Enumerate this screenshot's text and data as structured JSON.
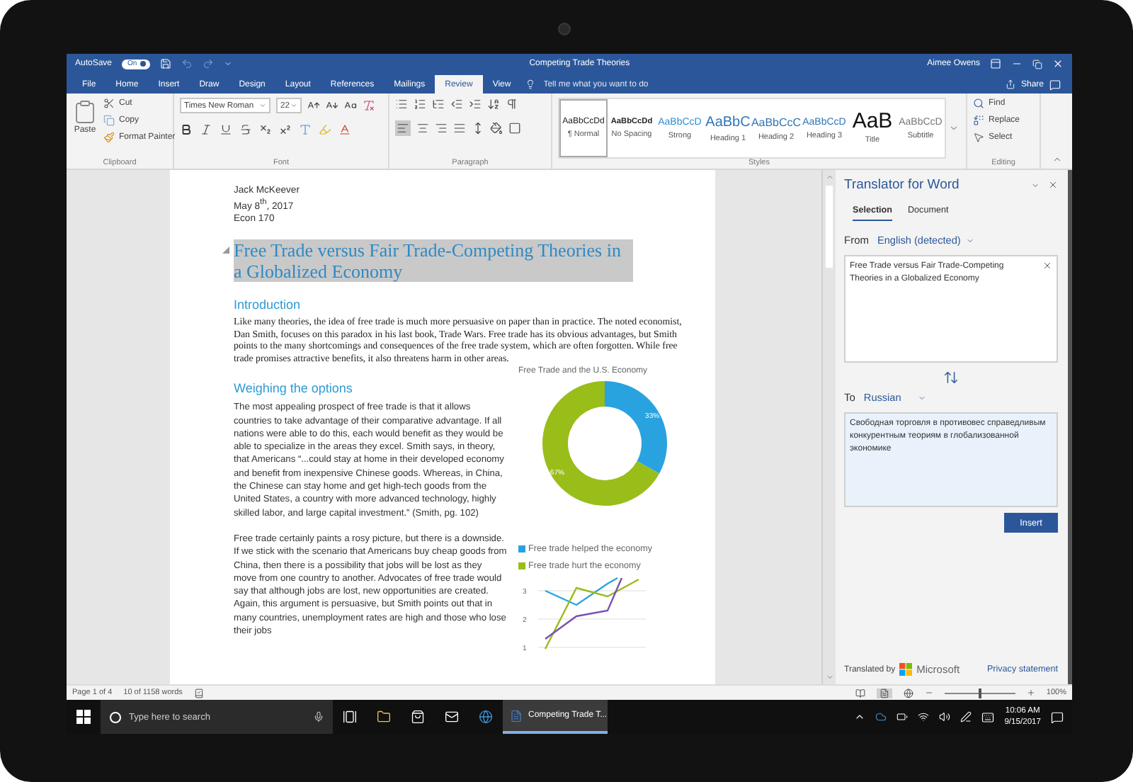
{
  "title_bar": {
    "autosave": {
      "label": "AutoSave",
      "state": "On",
      "on": true
    },
    "document_title": "Competing Trade Theories",
    "user": "Aimee Owens"
  },
  "ribbon_tabs": [
    {
      "label": "File",
      "selected": false
    },
    {
      "label": "Home",
      "selected": false
    },
    {
      "label": "Insert",
      "selected": false
    },
    {
      "label": "Draw",
      "selected": false
    },
    {
      "label": "Design",
      "selected": false
    },
    {
      "label": "Layout",
      "selected": false
    },
    {
      "label": "References",
      "selected": false
    },
    {
      "label": "Mailings",
      "selected": false
    },
    {
      "label": "Review",
      "selected": true
    },
    {
      "label": "View",
      "selected": false
    }
  ],
  "tell_me": {
    "placeholder": "Tell me what you want to do"
  },
  "share": "Share",
  "clipboard": {
    "paste": "Paste",
    "commands": [
      "Cut",
      "Copy",
      "Format Painter"
    ],
    "label": "Clipboard"
  },
  "font": {
    "name": "Times New Roman",
    "size": "22",
    "label": "Font"
  },
  "paragraph": {
    "label": "Paragraph"
  },
  "styles": {
    "items": [
      {
        "kind": "normal",
        "preview": "AaBbCcDd",
        "name": "¶ Normal",
        "selected": true
      },
      {
        "kind": "nospacing",
        "preview": "AaBbCcDd",
        "name": "No Spacing",
        "selected": false
      },
      {
        "kind": "strong",
        "preview": "AaBbCcD",
        "name": "Strong",
        "selected": false
      },
      {
        "kind": "heading1",
        "preview": "AaBbC",
        "name": "Heading 1",
        "selected": false
      },
      {
        "kind": "heading2",
        "preview": "AaBbCcC",
        "name": "Heading 2",
        "selected": false
      },
      {
        "kind": "heading3",
        "preview": "AaBbCcD",
        "name": "Heading 3",
        "selected": false
      },
      {
        "kind": "title",
        "preview": "AaB",
        "name": "Title",
        "selected": false
      },
      {
        "kind": "subtitle",
        "preview": "AaBbCcD",
        "name": "Subtitle",
        "selected": false
      }
    ],
    "label": "Styles"
  },
  "editing": {
    "commands": [
      "Find",
      "Replace",
      "Select"
    ],
    "label": "Editing"
  },
  "document": {
    "author_lines": [
      "Jack McKeever",
      "May 8$^{th}$, 2017",
      "Econ 170"
    ],
    "title": {
      "text": "Free Trade versus Fair Trade-Competing Theories in a Globalized Economy",
      "selected": true
    },
    "sections": [
      {
        "heading": "Introduction",
        "paragraphs": [
          "Like many theories, the idea of free trade is much more persuasive on paper than in practice. The noted economist, Dan Smith, focuses on this paradox in his last book, Trade Wars. Free trade has its obvious advantages, but Smith points to the many shortcomings and consequences of the free trade system, which are often forgotten. While free trade promises attractive benefits, it also threatens harm in other areas."
        ]
      },
      {
        "heading": "Weighing the options",
        "paragraphs": [
          "The most appealing prospect of free trade is that it allows countries to take advantage of their comparative advantage. If all nations were able to do this, each would benefit as they would be able to specialize in the areas they excel. Smith says, in theory, that Americans “...could stay at home in their developed economy and benefit from inexpensive Chinese goods. Whereas, in China, the Chinese can stay home and get high-tech goods from the United States, a country with more advanced technology, highly skilled labor, and large capital investment.” (Smith, pg. 102)",
          "Free trade certainly paints a rosy picture, but there is a downside. If we stick with the scenario that Americans buy cheap goods from China, then there is a possibility that jobs will be lost as they move from one country to another. Advocates of free trade would say that although jobs are lost, new opportunities are created. Again, this argument is persuasive, but Smith points out that in many countries, unemployment rates are high and those who lose their jobs"
        ]
      }
    ],
    "chart_data": {
      "type": "donut",
      "title": "Free Trade and the U.S. Economy",
      "categories": [
        "Free trade helped the economy",
        "Free trade hurt the economy"
      ],
      "colors": [
        "#29a3e0",
        "#99bd19"
      ],
      "series": [
        {
          "values": [
            33,
            67
          ]
        }
      ],
      "value_labels": [
        "33%",
        "67%"
      ]
    },
    "line_chart_ticks": [
      "3",
      "2",
      "1"
    ]
  },
  "translator": {
    "title": "Translator for Word",
    "tabs": [
      {
        "label": "Selection",
        "selected": true
      },
      {
        "label": "Document",
        "selected": false
      }
    ],
    "from_label": "From",
    "from_language": "English (detected)",
    "source_text": "Free Trade versus Fair Trade-Competing Theories in a Globalized Economy",
    "to_label": "To",
    "to_language": "Russian",
    "translation": "Свободная торговля в противовес справедливым конкурентным теориям в глобализованной экономике",
    "insert": "Insert",
    "credit": "Translated by",
    "provider": "Microsoft",
    "privacy_link": "Privacy statement"
  },
  "status_bar": {
    "page": "Page 1 of 4",
    "words": "10 of 1158 words",
    "zoom": {
      "level": 0.5,
      "reading": "100%"
    }
  },
  "taskbar": {
    "search": {
      "placeholder": "Type here to search"
    },
    "apps": [
      {
        "label": "Competing Trade T...",
        "selected": true
      }
    ],
    "time": "10:06 AM",
    "date": "9/15/2017"
  }
}
